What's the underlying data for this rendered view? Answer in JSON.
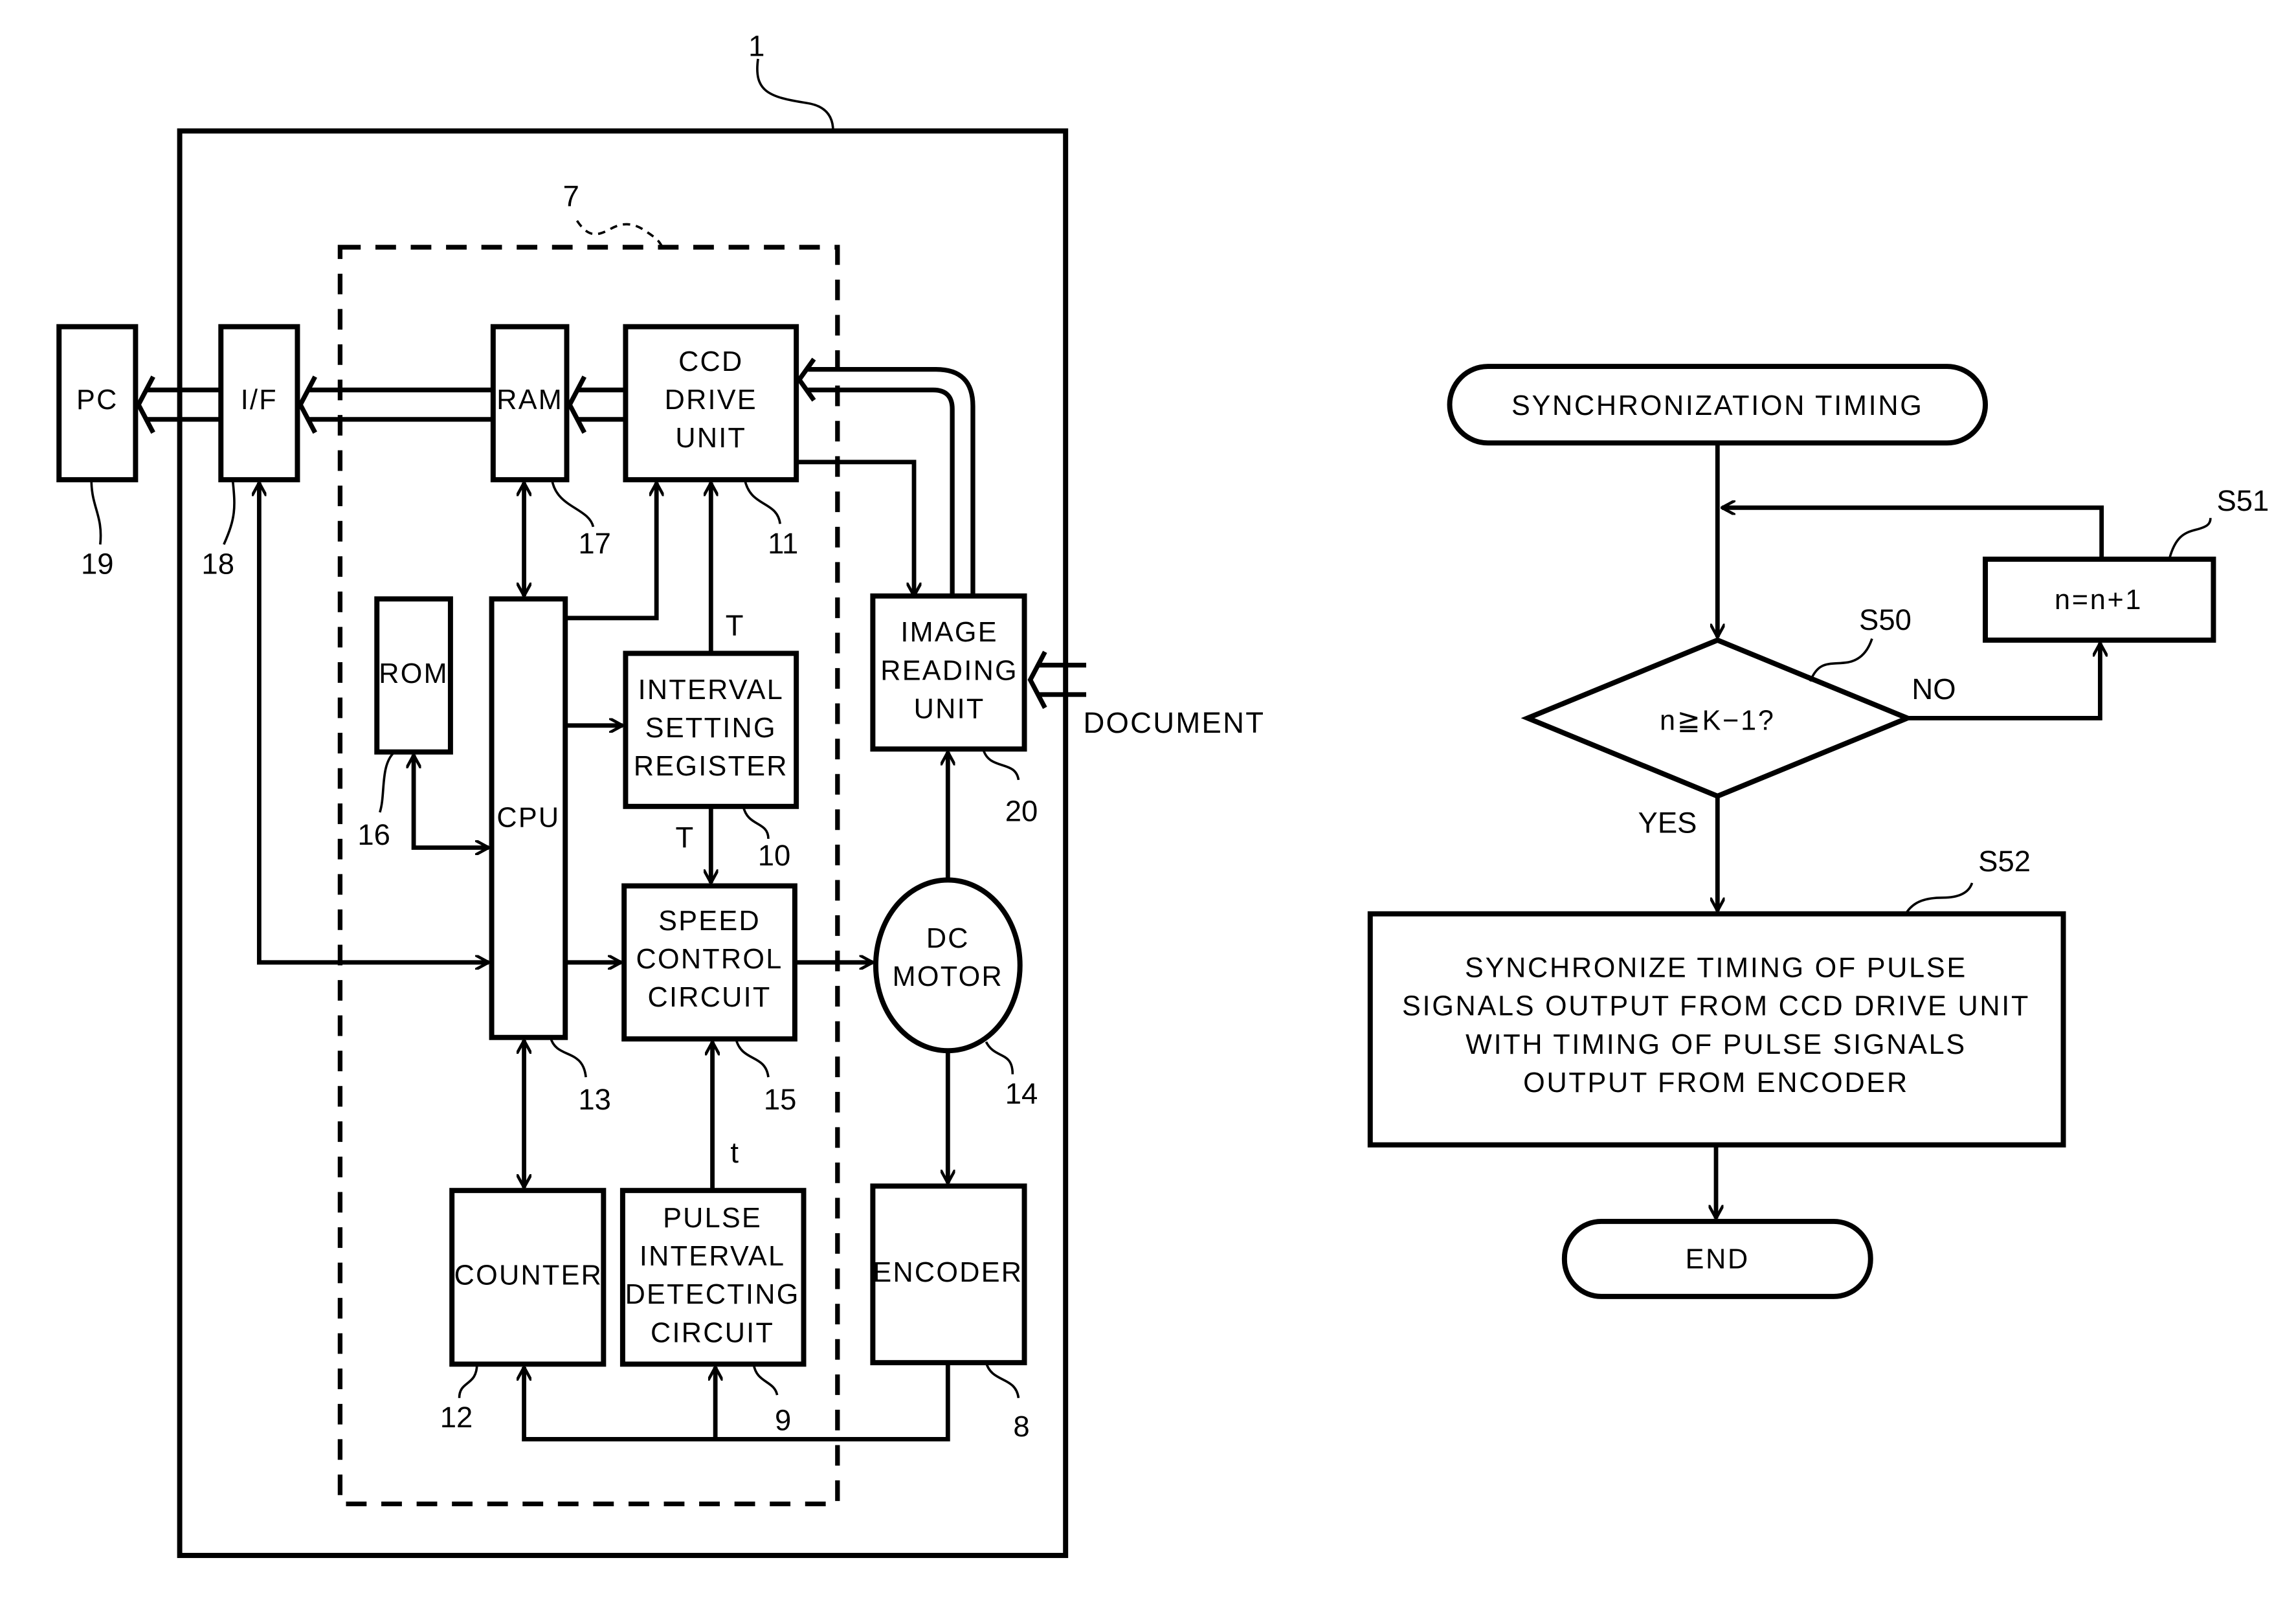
{
  "block_diagram": {
    "apparatus_ref": "1",
    "controller_ref": "7",
    "document_label": "DOCUMENT",
    "blocks": {
      "pc": {
        "label": [
          "PC"
        ],
        "ref": "19"
      },
      "if": {
        "label": [
          "I/F"
        ],
        "ref": "18"
      },
      "ram": {
        "label": [
          "RAM"
        ],
        "ref": "17"
      },
      "ccd": {
        "label": [
          "CCD",
          "DRIVE",
          "UNIT"
        ],
        "ref": "11"
      },
      "rom": {
        "label": [
          "ROM"
        ],
        "ref": "16"
      },
      "cpu": {
        "label": [
          "CPU"
        ],
        "ref": "13"
      },
      "isr": {
        "label": [
          "INTERVAL",
          "SETTING",
          "REGISTER"
        ],
        "ref": "10"
      },
      "scc": {
        "label": [
          "SPEED",
          "CONTROL",
          "CIRCUIT"
        ],
        "ref": "15"
      },
      "iru": {
        "label": [
          "IMAGE",
          "READING",
          "UNIT"
        ],
        "ref": "20"
      },
      "motor": {
        "label": [
          "DC",
          "MOTOR"
        ],
        "ref": "14"
      },
      "counter": {
        "label": [
          "COUNTER"
        ],
        "ref": "12"
      },
      "pidc": {
        "label": [
          "PULSE",
          "INTERVAL",
          "DETECTING",
          "CIRCUIT"
        ],
        "ref": "9"
      },
      "encoder": {
        "label": [
          "ENCODER"
        ],
        "ref": "8"
      }
    },
    "signals": {
      "t_upper": "T",
      "t_middle": "T",
      "t_lower": "t"
    }
  },
  "flowchart": {
    "start": "SYNCHRONIZATION TIMING",
    "decision": {
      "text": "n≧K−1?",
      "ref": "S50",
      "yes": "YES",
      "no": "NO"
    },
    "increment": {
      "text": "n=n+1",
      "ref": "S51"
    },
    "process": {
      "ref": "S52",
      "lines": [
        "SYNCHRONIZE TIMING OF PULSE",
        "SIGNALS OUTPUT FROM CCD DRIVE UNIT",
        "WITH TIMING OF PULSE SIGNALS",
        "OUTPUT FROM ENCODER"
      ]
    },
    "end": "END"
  }
}
